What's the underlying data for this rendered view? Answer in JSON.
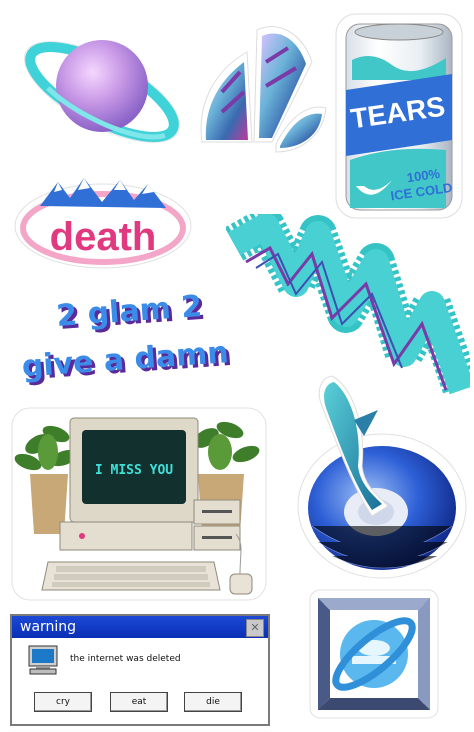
{
  "stickers": {
    "can": {
      "brand": "TEARS",
      "tagline_top": "100%",
      "tagline_bottom": "ICE COLD"
    },
    "death_logo": {
      "word": "death"
    },
    "slogan": {
      "line1": "2 glam 2",
      "line2": "give a damn"
    },
    "computer": {
      "screen_text": "I MISS YOU"
    },
    "warning_window": {
      "title": "warning",
      "close_glyph": "✕",
      "message": "the internet was deleted",
      "buttons": [
        "cry",
        "eat",
        "die"
      ]
    }
  },
  "colors": {
    "teal": "#33c7c9",
    "blue": "#2f6fd6",
    "purple": "#7a3aa8",
    "pink": "#e0397f",
    "window_title": "#0a2fb5"
  }
}
